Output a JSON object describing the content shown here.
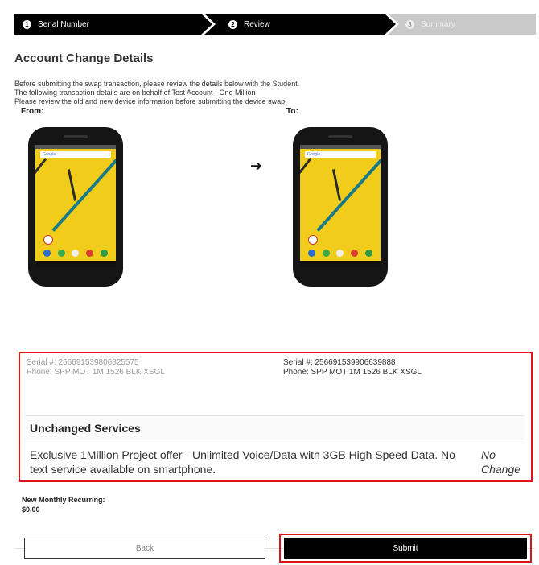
{
  "stepper": {
    "steps": [
      {
        "number": "1",
        "label": "Serial Number"
      },
      {
        "number": "2",
        "label": "Review"
      },
      {
        "number": "3",
        "label": "Summary"
      }
    ]
  },
  "page": {
    "title": "Account Change Details",
    "intro": [
      "Before submitting the swap transaction, please review the details below with the Student.",
      "The following transaction details are on behalf of Test Account - One Million",
      "Please review the old and new device information before submitting the device swap."
    ]
  },
  "devices": {
    "from_label": "From:",
    "to_label": "To:",
    "search_text": "Google",
    "old": {
      "serial": "Serial #: 256691539806825575",
      "phone": "Phone: SPP MOT 1M 1526 BLK XSGL"
    },
    "new": {
      "serial": "Serial #: 256691539906639888",
      "phone": "Phone: SPP MOT 1M 1526 BLK XSGL"
    }
  },
  "services": {
    "header": "Unchanged Services",
    "items": [
      {
        "description": "Exclusive 1Million Project offer - Unlimited Voice/Data with 3GB High Speed Data. No text service available on smartphone.",
        "status": "No Change"
      }
    ]
  },
  "recurring": {
    "label": "New Monthly Recurring:",
    "value": "$0.00"
  },
  "actions": {
    "back_label": "Back",
    "submit_label": "Submit"
  },
  "colors": {
    "accent_red": "#e0131b",
    "step_active": "#000000",
    "step_inactive": "#c9c9c9"
  }
}
